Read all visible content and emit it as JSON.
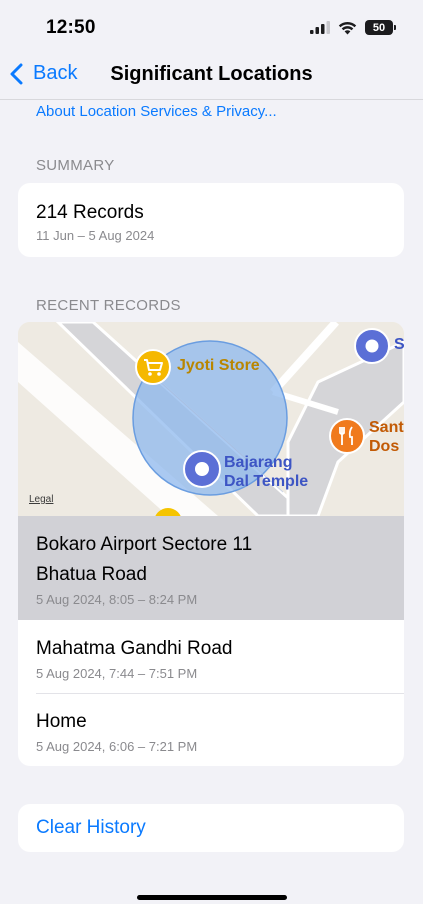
{
  "status_bar": {
    "time": "12:50",
    "battery_level": "50"
  },
  "nav": {
    "back_label": "Back",
    "title": "Significant Locations"
  },
  "about_link": "About Location Services & Privacy...",
  "summary": {
    "header": "SUMMARY",
    "records": "214 Records",
    "date_range": "11 Jun – 5 Aug 2024"
  },
  "recent": {
    "header": "RECENT RECORDS",
    "map": {
      "legal": "Legal",
      "poi": [
        {
          "name": "Jyoti Store",
          "icon": "cart-icon",
          "color": "#f5b800"
        },
        {
          "name_line1": "Bajarang",
          "name_line2": "Dal Temple",
          "icon": "place-dot-icon",
          "color": "#5b6fd6"
        },
        {
          "name_line1": "Sant",
          "name_line2": "Dos",
          "icon": "fork-knife-icon",
          "color": "#f07a1d"
        },
        {
          "name": "S",
          "icon": "place-dot-icon",
          "color": "#5b6fd6"
        }
      ]
    },
    "items": [
      {
        "line1": "Bokaro Airport Sectore 11",
        "line2": "Bhatua Road",
        "time": "5 Aug 2024, 8:05 – 8:24 PM",
        "selected": true
      },
      {
        "line1": "Mahatma Gandhi Road",
        "time": "5 Aug 2024, 7:44 – 7:51 PM"
      },
      {
        "line1": "Home",
        "time": "5 Aug 2024, 6:06 – 7:21 PM"
      }
    ]
  },
  "clear_history": "Clear History",
  "colors": {
    "accent": "#0a7aff",
    "background": "#f2f2f7",
    "selected_row": "#d1d1d6"
  }
}
